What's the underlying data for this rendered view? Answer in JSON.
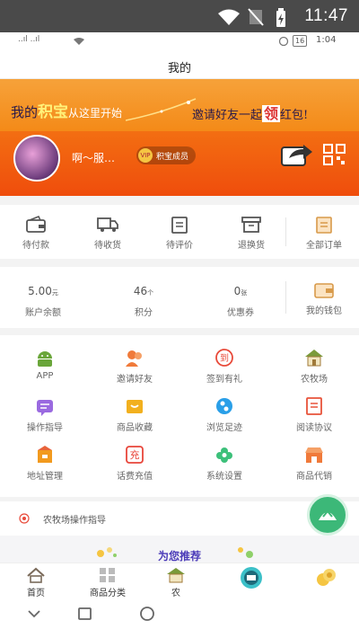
{
  "status_bar": {
    "time": "11:47"
  },
  "inner_status": {
    "time": "1:04",
    "signal_left": "..ıl ..ıl",
    "battery_label": "16"
  },
  "header": {
    "title": "我的"
  },
  "banner": {
    "slogan_left": "我的",
    "slogan_brand": "积宝",
    "slogan_mid": "从这里开始",
    "slogan_right_a": "邀请好友一起",
    "slogan_right_big": "领",
    "slogan_right_b": "红包!",
    "username": "啊～服…",
    "badge_icon": "VIP",
    "badge": "积宝成员"
  },
  "orders": [
    {
      "label": "待付款",
      "icon": "wallet-icon"
    },
    {
      "label": "待收货",
      "icon": "truck-icon"
    },
    {
      "label": "待评价",
      "icon": "clipboard-icon"
    },
    {
      "label": "退换货",
      "icon": "box-icon"
    },
    {
      "label": "全部订单",
      "icon": "orders-icon"
    }
  ],
  "account": [
    {
      "value": "5.00",
      "unit": "元",
      "label": "账户余额"
    },
    {
      "value": "46",
      "unit": "个",
      "label": "积分"
    },
    {
      "value": "0",
      "unit": "张",
      "label": "优惠券"
    },
    {
      "label": "我的钱包"
    }
  ],
  "services": [
    {
      "label": "APP",
      "icon": "android-icon",
      "color": "#6aa63a"
    },
    {
      "label": "邀请好友",
      "icon": "people-icon",
      "color": "#f07a3a"
    },
    {
      "label": "签到有礼",
      "icon": "checkin-icon",
      "color": "#e84a3a"
    },
    {
      "label": "农牧场",
      "icon": "farm-icon",
      "color": "#7a9a3a"
    },
    {
      "label": "操作指导",
      "icon": "guide-icon",
      "color": "#9a6ae0"
    },
    {
      "label": "商品收藏",
      "icon": "collect-icon",
      "color": "#f2b01e"
    },
    {
      "label": "浏览足迹",
      "icon": "footprint-icon",
      "color": "#2a9fe8"
    },
    {
      "label": "阅读协议",
      "icon": "agreement-icon",
      "color": "#e8533a"
    },
    {
      "label": "地址管理",
      "icon": "address-icon",
      "color": "#f29a1e"
    },
    {
      "label": "话费充值",
      "icon": "recharge-icon",
      "color": "#e8453a",
      "glyph": "充"
    },
    {
      "label": "系统设置",
      "icon": "settings-icon",
      "color": "#3cc07a"
    },
    {
      "label": "商品代销",
      "icon": "shop-icon",
      "color": "#f07a3a"
    }
  ],
  "tip": {
    "text": "农牧场操作指导"
  },
  "recommend": {
    "title": "为您推荐"
  },
  "tabs": [
    {
      "label": "首页",
      "icon": "home-icon"
    },
    {
      "label": "商品分类",
      "icon": "category-icon"
    },
    {
      "label": "农",
      "icon": "farm-tab-icon"
    },
    {
      "label": "",
      "icon": "cart-icon"
    },
    {
      "label": "",
      "icon": "coin-icon"
    }
  ]
}
